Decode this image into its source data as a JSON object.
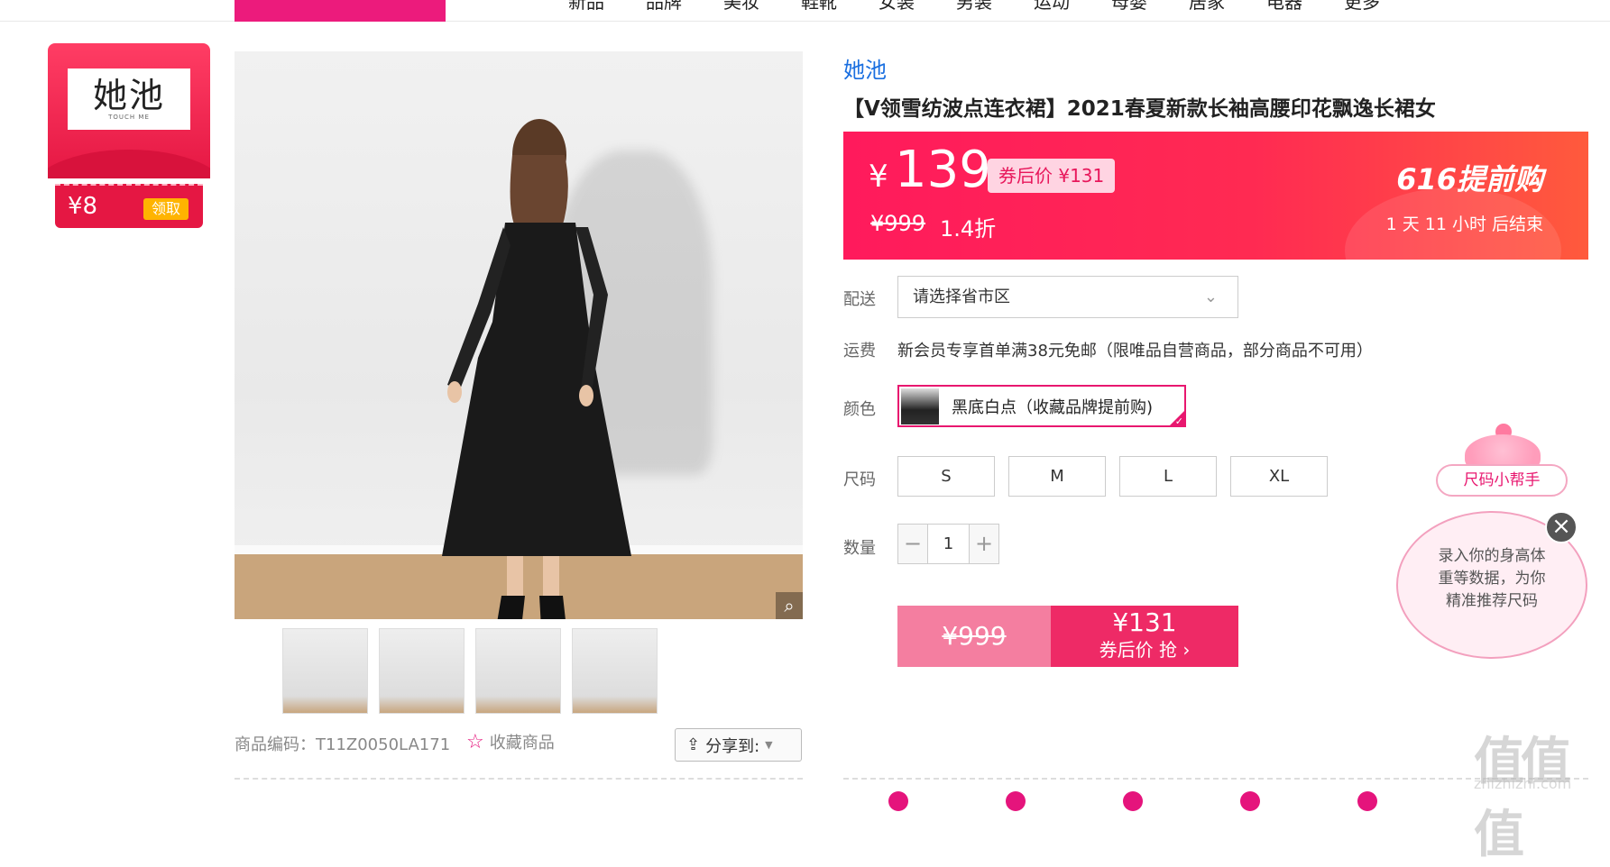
{
  "nav": {
    "items": [
      "新品",
      "品牌",
      "美妆",
      "鞋靴",
      "女装",
      "男装",
      "运动",
      "母婴",
      "居家",
      "电器",
      "更多"
    ]
  },
  "brand_coupon": {
    "logo_text": "她池",
    "logo_sub": "TOUCH ME",
    "amount": "¥8",
    "action": "领取"
  },
  "gallery": {
    "zoom_icon": "magnifier-icon",
    "thumbnails": 4
  },
  "meta": {
    "sku_label": "商品编码：T11Z0050LA171",
    "favorite": "收藏商品",
    "share": "分享到:"
  },
  "product": {
    "brand": "她池",
    "title": "【V领雪纺波点连衣裙】2021春夏新款长袖高腰印花飘逸长裙女"
  },
  "price": {
    "currency": "¥",
    "current": "139",
    "coupon_price": "券后价 ¥131",
    "original": "¥999",
    "discount": "1.4折",
    "event": "616提前购",
    "countdown": "1 天 11 小时 后结束"
  },
  "delivery": {
    "label": "配送",
    "placeholder": "请选择省市区"
  },
  "shipping": {
    "label": "运费",
    "text": "新会员专享首单满38元免邮（限唯品自营商品，部分商品不可用）"
  },
  "color": {
    "label": "颜色",
    "option": "黑底白点（收藏品牌提前购)"
  },
  "size": {
    "label": "尺码",
    "options": [
      "S",
      "M",
      "L",
      "XL"
    ]
  },
  "quantity": {
    "label": "数量",
    "minus": "−",
    "value": "1",
    "plus": "+"
  },
  "buy": {
    "original": "¥999",
    "price": "¥131",
    "action": "券后价 抢 ›"
  },
  "helper": {
    "pill": "尺码小帮手",
    "bubble_lines": [
      "录入你的身高体",
      "重等数据，为你",
      "精准推荐尺码"
    ],
    "close": "×"
  },
  "watermark": {
    "main": "值值值",
    "sub": "zhizhizhi.com"
  },
  "colors": {
    "accent": "#e5147c",
    "banner": "#ff2a52",
    "link": "#1a6fe0"
  }
}
